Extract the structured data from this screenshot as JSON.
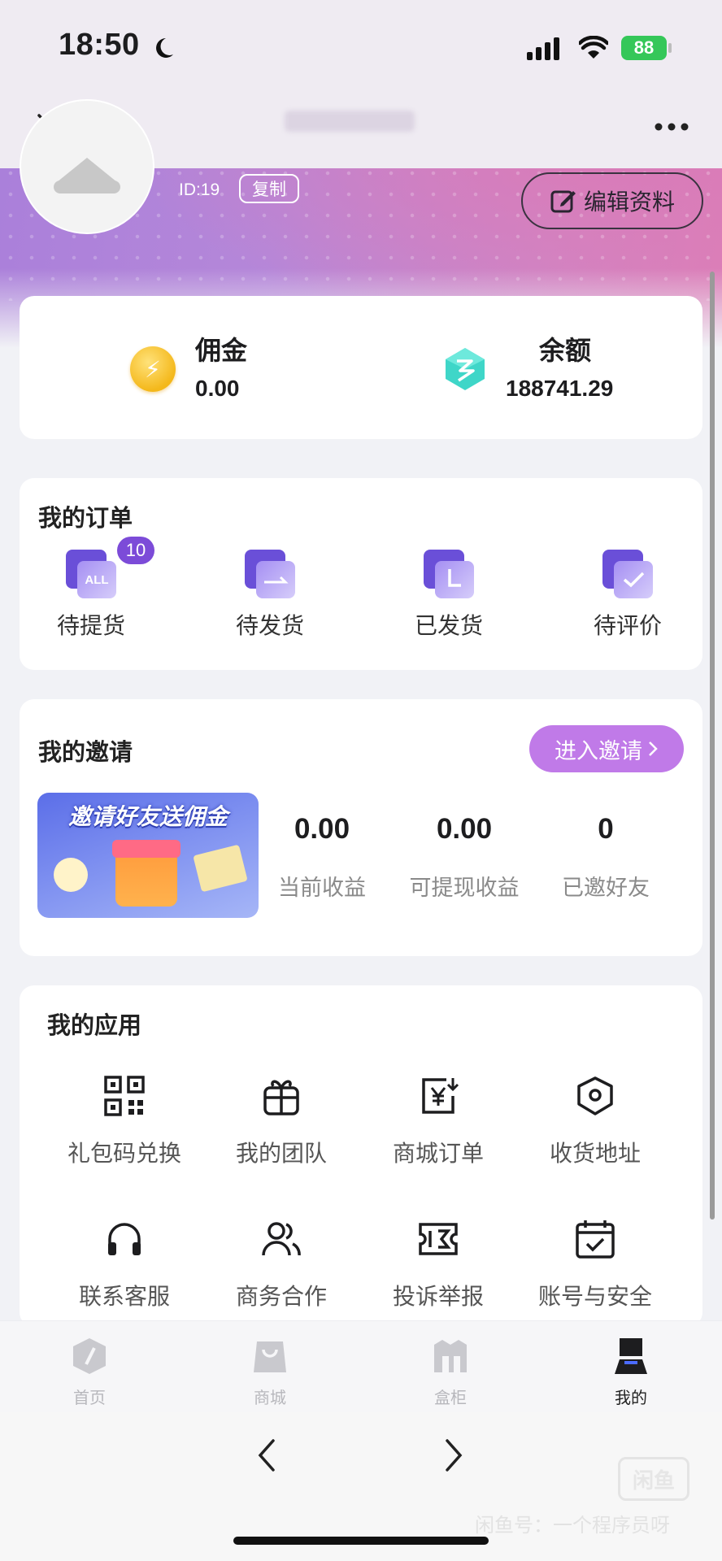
{
  "status_bar": {
    "time": "18:50",
    "battery": "88"
  },
  "profile": {
    "id_text": "ID:19",
    "copy_label": "复制",
    "edit_label": "编辑资料"
  },
  "balance": {
    "commission_label": "佣金",
    "commission_value": "0.00",
    "balance_label": "余额",
    "balance_value": "188741.29"
  },
  "orders": {
    "title": "我的订单",
    "badge": "10",
    "items": [
      {
        "label": "待提货",
        "icon": "all-orders-icon",
        "icon_text": "ALL"
      },
      {
        "label": "待发货",
        "icon": "to-ship-icon"
      },
      {
        "label": "已发货",
        "icon": "shipped-icon"
      },
      {
        "label": "待评价",
        "icon": "to-review-icon"
      }
    ]
  },
  "invite": {
    "title": "我的邀请",
    "button_label": "进入邀请",
    "banner_text": "邀请好友送佣金",
    "stats": [
      {
        "value": "0.00",
        "label": "当前收益"
      },
      {
        "value": "0.00",
        "label": "可提现收益"
      },
      {
        "value": "0",
        "label": "已邀好友"
      }
    ]
  },
  "apps": {
    "title": "我的应用",
    "items": [
      {
        "label": "礼包码兑换",
        "icon": "qr-code-icon"
      },
      {
        "label": "我的团队",
        "icon": "gift-icon"
      },
      {
        "label": "商城订单",
        "icon": "order-yen-icon"
      },
      {
        "label": "收货地址",
        "icon": "location-icon"
      },
      {
        "label": "联系客服",
        "icon": "headset-icon"
      },
      {
        "label": "商务合作",
        "icon": "users-icon"
      },
      {
        "label": "投诉举报",
        "icon": "ticket-icon"
      },
      {
        "label": "账号与安全",
        "icon": "calendar-check-icon"
      }
    ]
  },
  "tabs": [
    {
      "label": "首页",
      "icon": "home-box-icon"
    },
    {
      "label": "商城",
      "icon": "shop-bag-icon"
    },
    {
      "label": "盒柜",
      "icon": "cabinet-icon"
    },
    {
      "label": "我的",
      "icon": "profile-tab-icon",
      "active": true
    }
  ],
  "watermark": {
    "logo": "闲鱼",
    "text": "闲鱼号：一个程序员呀"
  },
  "colors": {
    "accent": "#7c4bd8",
    "invite_button": "#c07ae8",
    "gradient_start": "#a97fda",
    "gradient_end": "#de7fb6"
  }
}
